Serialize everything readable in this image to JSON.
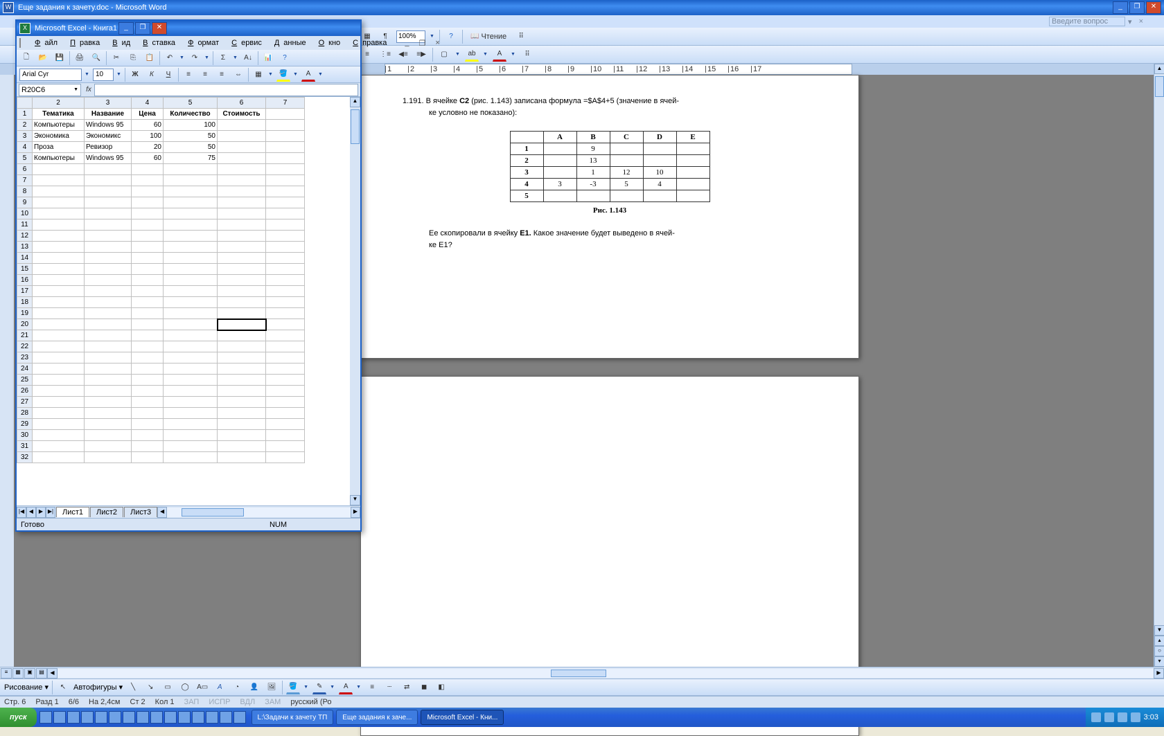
{
  "word": {
    "title": "Еще задания к зачету.doc - Microsoft Word",
    "help_placeholder": "Введите вопрос",
    "zoom": "100%",
    "reading": "Чтение",
    "ruler_numbers": [
      "1",
      "2",
      "3",
      "4",
      "5",
      "6",
      "7",
      "8",
      "9",
      "10",
      "11",
      "12",
      "13",
      "14",
      "15",
      "16",
      "17"
    ],
    "draw": {
      "draw": "Рисование",
      "autoshapes": "Автофигуры"
    },
    "status": {
      "page": "Стр. 6",
      "sect": "Разд 1",
      "pgof": "6/6",
      "at": "На 2,4см",
      "ln": "Ст 2",
      "col": "Кол 1",
      "rec": "ЗАП",
      "trk": "ИСПР",
      "ext": "ВДЛ",
      "ovr": "ЗАМ",
      "lang": "русский (Ро"
    }
  },
  "document": {
    "line1_pre": "1.191. В ячейке ",
    "c2": "С2",
    "line1_mid": " (рис. 1.143) записана формула =$A$4+5 (значение в ячей-",
    "line2": "ке условно не показано):",
    "table_head": [
      "",
      "A",
      "B",
      "C",
      "D",
      "E"
    ],
    "table_rows": [
      [
        "1",
        "",
        "9",
        "",
        "",
        ""
      ],
      [
        "2",
        "",
        "13",
        "",
        "",
        ""
      ],
      [
        "3",
        "",
        "1",
        "12",
        "10",
        ""
      ],
      [
        "4",
        "3",
        "-3",
        "5",
        "4",
        ""
      ],
      [
        "5",
        "",
        "",
        "",
        "",
        ""
      ]
    ],
    "caption": "Рис. 1.143",
    "line3_pre": "Ее скопировали в ячейку ",
    "e1": "Е1.",
    "line3_post": " Какое значение будет выведено в ячей-",
    "line4": "ке Е1?"
  },
  "excel": {
    "title": "Microsoft Excel - Книга1",
    "menu": [
      "Файл",
      "Правка",
      "Вид",
      "Вставка",
      "Формат",
      "Сервис",
      "Данные",
      "Окно",
      "Справка"
    ],
    "font": "Arial Cyr",
    "fontsize": "10",
    "namebox": "R20C6",
    "col_headers": [
      "2",
      "3",
      "4",
      "5",
      "6",
      "7"
    ],
    "headers": [
      "Тематика",
      "Название",
      "Цена",
      "Количество",
      "Стоимость"
    ],
    "rows": [
      [
        "Компьютеры",
        "Windows 95",
        "60",
        "100",
        ""
      ],
      [
        "Экономика",
        "Экономикс",
        "100",
        "50",
        ""
      ],
      [
        "Проза",
        "Ревизор",
        "20",
        "50",
        ""
      ],
      [
        "Компьютеры",
        "Windows 95",
        "60",
        "75",
        ""
      ]
    ],
    "sheets": [
      "Лист1",
      "Лист2",
      "Лист3"
    ],
    "status": "Готово",
    "status_num": "NUM"
  },
  "taskbar": {
    "start": "пуск",
    "tasks": [
      {
        "label": "L:\\Задачи к зачету ТП",
        "active": false
      },
      {
        "label": "Еще задания к заче...",
        "active": false
      },
      {
        "label": "Microsoft Excel - Кни...",
        "active": true
      }
    ],
    "clock": "3:03"
  }
}
